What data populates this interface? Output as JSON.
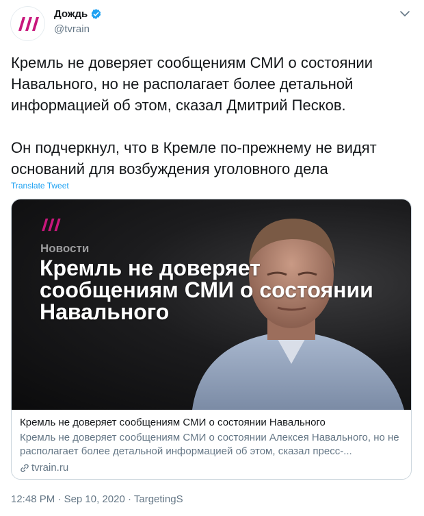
{
  "author": {
    "display_name": "Дождь",
    "handle": "@tvrain"
  },
  "tweet": {
    "paragraph_1": "Кремль не доверяет сообщениям СМИ о состоянии Навального, но не располагает более детальной информацией об этом, сказал Дмитрий Песков.",
    "paragraph_2": "Он подчеркнул, что в Кремле по-прежнему не видят оснований для возбуждения уголовного дела",
    "translate_label": "Translate Tweet"
  },
  "card": {
    "image_category": "Новости",
    "image_headline": "Кремль не доверяет сообщениям СМИ о состоянии Навального",
    "title": "Кремль не доверяет сообщениям СМИ о состоянии Навального",
    "description": "Кремль не доверяет сообщениям СМИ о состоянии Алексея Навального, но не располагает более детальной информацией об этом, сказал пресс-...",
    "domain": "tvrain.ru"
  },
  "meta": {
    "time": "12:48 PM",
    "separator": " · ",
    "date": "Sep 10, 2020",
    "source": "TargetingS"
  },
  "colors": {
    "brand_magenta": "#c8177c",
    "link_blue": "#1da1f2",
    "muted_gray": "#657786"
  },
  "icons": [
    "tvrain-logo",
    "verified-badge-icon",
    "chevron-down-icon",
    "link-icon"
  ]
}
